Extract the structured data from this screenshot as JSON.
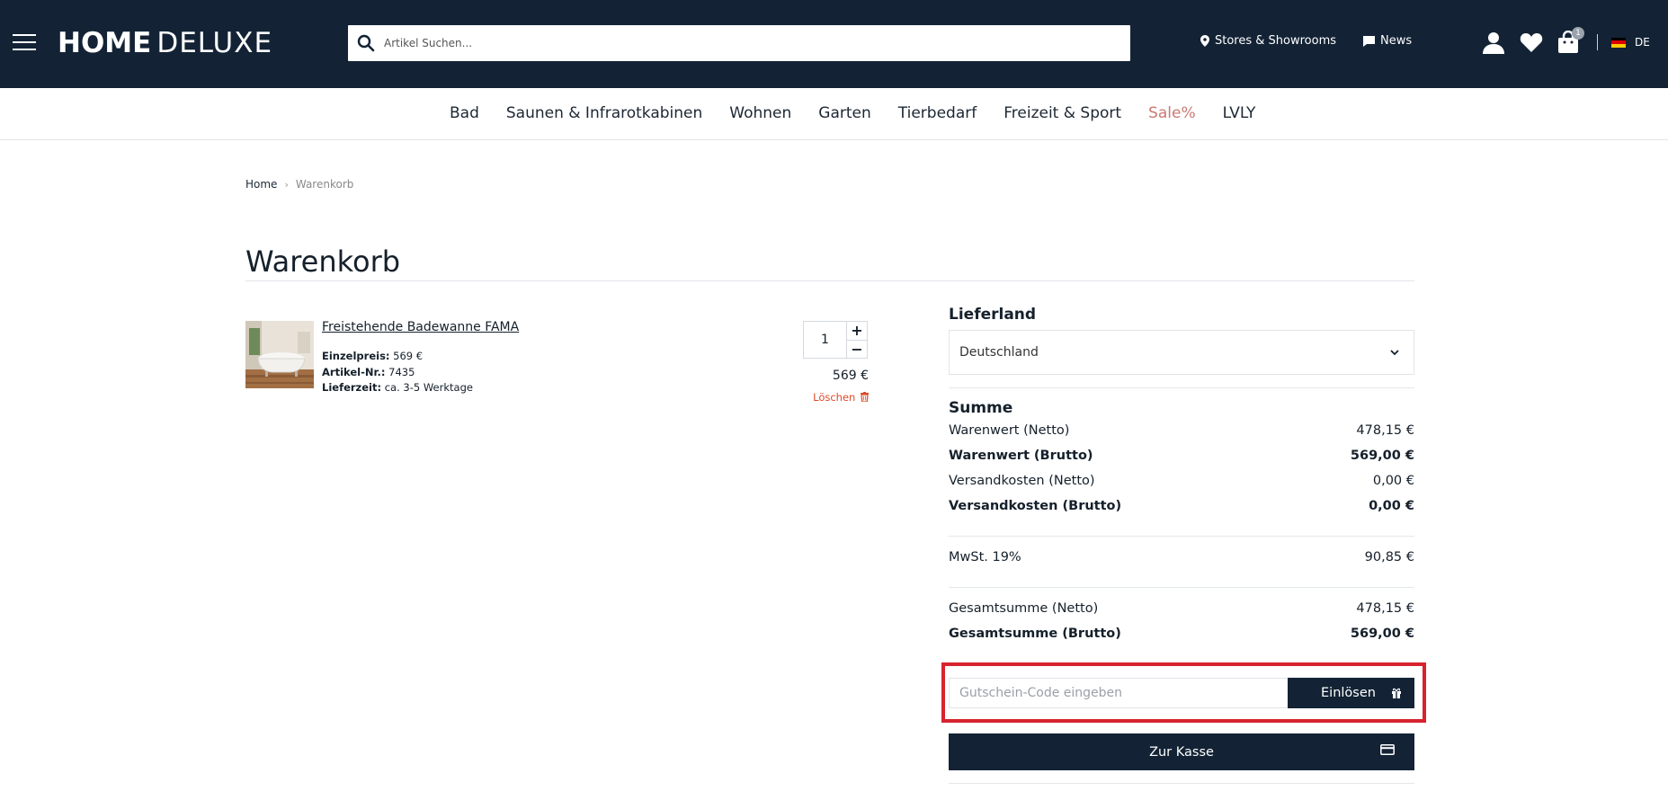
{
  "header": {
    "logo_home": "HOME",
    "logo_deluxe": "DELUXE",
    "search_placeholder": "Artikel Suchen...",
    "stores_label": "Stores & Showrooms",
    "news_label": "News",
    "cart_count": "1",
    "language": "DE"
  },
  "nav": {
    "items": [
      "Bad",
      "Saunen & Infrarotkabinen",
      "Wohnen",
      "Garten",
      "Tierbedarf",
      "Freizeit & Sport",
      "Sale%",
      "LVLY"
    ],
    "sale_color": "#c97a74"
  },
  "breadcrumb": {
    "home": "Home",
    "current": "Warenkorb"
  },
  "page": {
    "title": "Warenkorb"
  },
  "cart": {
    "item": {
      "name": "Freistehende Badewanne FAMA",
      "unit_price_label": "Einzelpreis:",
      "unit_price": "569 €",
      "article_label": "Artikel-Nr.:",
      "article_no": "7435",
      "delivery_label": "Lieferzeit:",
      "delivery": "ca. 3-5 Werktage",
      "quantity": "1",
      "price": "569 €",
      "delete_label": "Löschen"
    }
  },
  "summary": {
    "country_heading": "Lieferland",
    "country_selected": "Deutschland",
    "sum_heading": "Summe",
    "rows": [
      {
        "label": "Warenwert (Netto)",
        "value": "478,15 €"
      },
      {
        "label": "Warenwert (Brutto)",
        "value": "569,00 €"
      },
      {
        "label": "Versandkosten (Netto)",
        "value": "0,00 €"
      },
      {
        "label": "Versandkosten (Brutto)",
        "value": "0,00 €"
      }
    ],
    "tax": {
      "label": "MwSt. 19%",
      "value": "90,85 €"
    },
    "totals": [
      {
        "label": "Gesamtsumme (Netto)",
        "value": "478,15 €"
      },
      {
        "label": "Gesamtsumme (Brutto)",
        "value": "569,00 €"
      }
    ],
    "coupon_placeholder": "Gutschein-Code eingeben",
    "redeem_label": "Einlösen",
    "checkout_label": "Zur Kasse"
  },
  "colors": {
    "header_bg": "#132335",
    "accent_delete": "#e04a2a",
    "highlight_outline": "#d7232f"
  }
}
